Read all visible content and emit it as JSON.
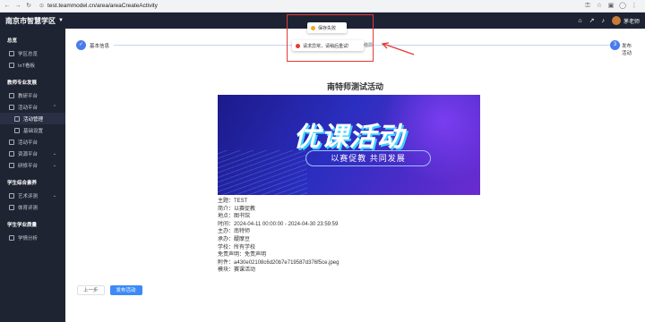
{
  "browser": {
    "url": "test.teammodel.cn/area/areaCreateActivity"
  },
  "app": {
    "school_name": "南京市智慧学区",
    "user_name": "茅老师"
  },
  "sidebar": {
    "sections": [
      {
        "title": "总览",
        "items": [
          {
            "label": "学区总览"
          },
          {
            "label": "IoT看板"
          }
        ]
      },
      {
        "title": "教师专业发展",
        "items": [
          {
            "label": "教研平台"
          },
          {
            "label": "活动平台"
          },
          {
            "label": "活动管理",
            "sub": true
          },
          {
            "label": "基础设置",
            "sub": true
          },
          {
            "label": "活动平台"
          },
          {
            "label": "资源平台"
          },
          {
            "label": "研修平台"
          }
        ]
      },
      {
        "title": "学生综合素养",
        "items": [
          {
            "label": "艺术评测"
          },
          {
            "label": "体育评测"
          }
        ]
      },
      {
        "title": "学生学业质量",
        "items": [
          {
            "label": "学情分析"
          }
        ]
      }
    ]
  },
  "steps": {
    "step1_label": "基本信息",
    "step3_num": "3",
    "step3_label": "发布活动"
  },
  "activity": {
    "title": "南特师测试活动",
    "banner_title": "优课活动",
    "banner_sub": "以赛促教 共同发展",
    "fields": [
      {
        "k": "主题：",
        "v": "TEST"
      },
      {
        "k": "简介：",
        "v": "以赛促教"
      },
      {
        "k": "地点：",
        "v": "图书馆"
      },
      {
        "k": "时间：",
        "v": "2024-04-11 00:00:00 - 2024-04-30 23:59:59"
      },
      {
        "k": "主办：",
        "v": "南特师"
      },
      {
        "k": "承办：",
        "v": "醍摩豆"
      },
      {
        "k": "学校：",
        "v": "所有学校"
      },
      {
        "k": "免责声明：",
        "v": "免责声明"
      },
      {
        "k": "附件：",
        "v": "a430e02108c6d20b7e719587d376f5ce.jpeg"
      },
      {
        "k": "模块：",
        "v": "赛课活动"
      }
    ]
  },
  "buttons": {
    "prev": "上一步",
    "publish": "发布活动"
  },
  "toasts": {
    "save_fail": "保存失败",
    "request_error": "请求异常，请稍后重试!",
    "faded": "借异"
  },
  "colors": {
    "accent": "#3d8af7",
    "sidebar_bg": "#1f2433",
    "annotation": "#e53935",
    "warning": "#f5a623",
    "error": "#e53935"
  }
}
